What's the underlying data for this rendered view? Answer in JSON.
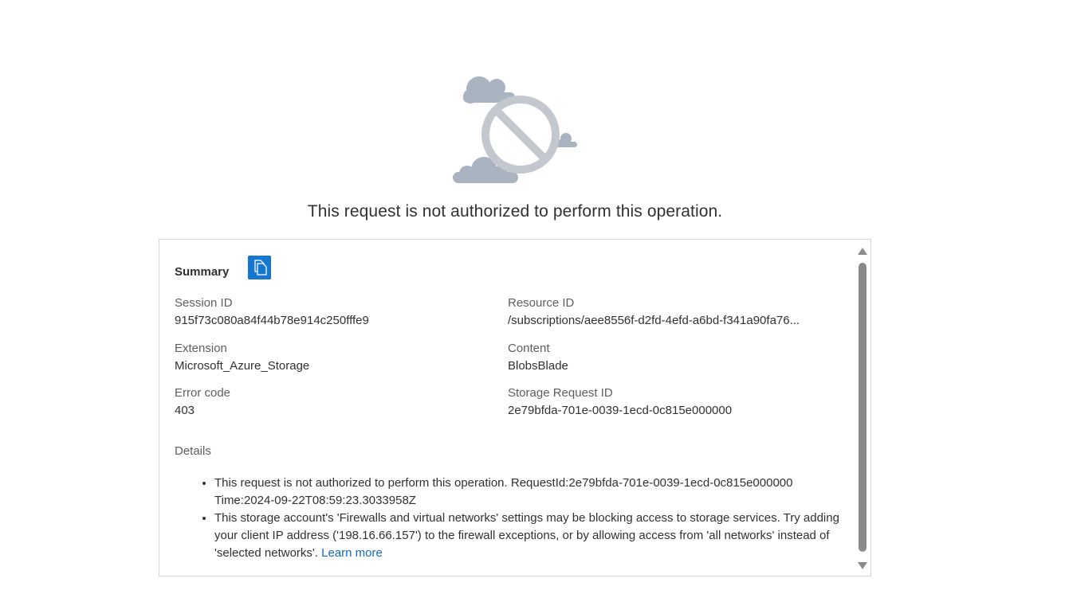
{
  "error": {
    "headline": "This request is not authorized to perform this operation.",
    "illustration_icon": "blocked-cloud-icon"
  },
  "summary": {
    "title": "Summary",
    "copy_icon": "copy-icon",
    "fields": {
      "session_id": {
        "label": "Session ID",
        "value": "915f73c080a84f44b78e914c250fffe9"
      },
      "resource_id": {
        "label": "Resource ID",
        "value": "/subscriptions/aee8556f-d2fd-4efd-a6bd-f341a90fa76..."
      },
      "extension": {
        "label": "Extension",
        "value": "Microsoft_Azure_Storage"
      },
      "content": {
        "label": "Content",
        "value": "BlobsBlade"
      },
      "error_code": {
        "label": "Error code",
        "value": "403"
      },
      "storage_request_id": {
        "label": "Storage Request ID",
        "value": "2e79bfda-701e-0039-1ecd-0c815e000000"
      }
    }
  },
  "details": {
    "label": "Details",
    "items": [
      "This request is not authorized to perform this operation. RequestId:2e79bfda-701e-0039-1ecd-0c815e000000 Time:2024-09-22T08:59:23.3033958Z",
      "This storage account's 'Firewalls and virtual networks' settings may be blocking access to storage services. Try adding your client IP address ('198.16.66.157') to the firewall exceptions, or by allowing access from 'all networks' instead of 'selected networks'."
    ],
    "learn_more": "Learn more"
  },
  "colors": {
    "accent": "#1577cf",
    "link": "#0f6cbd",
    "illustration": "#a9b1bc"
  }
}
